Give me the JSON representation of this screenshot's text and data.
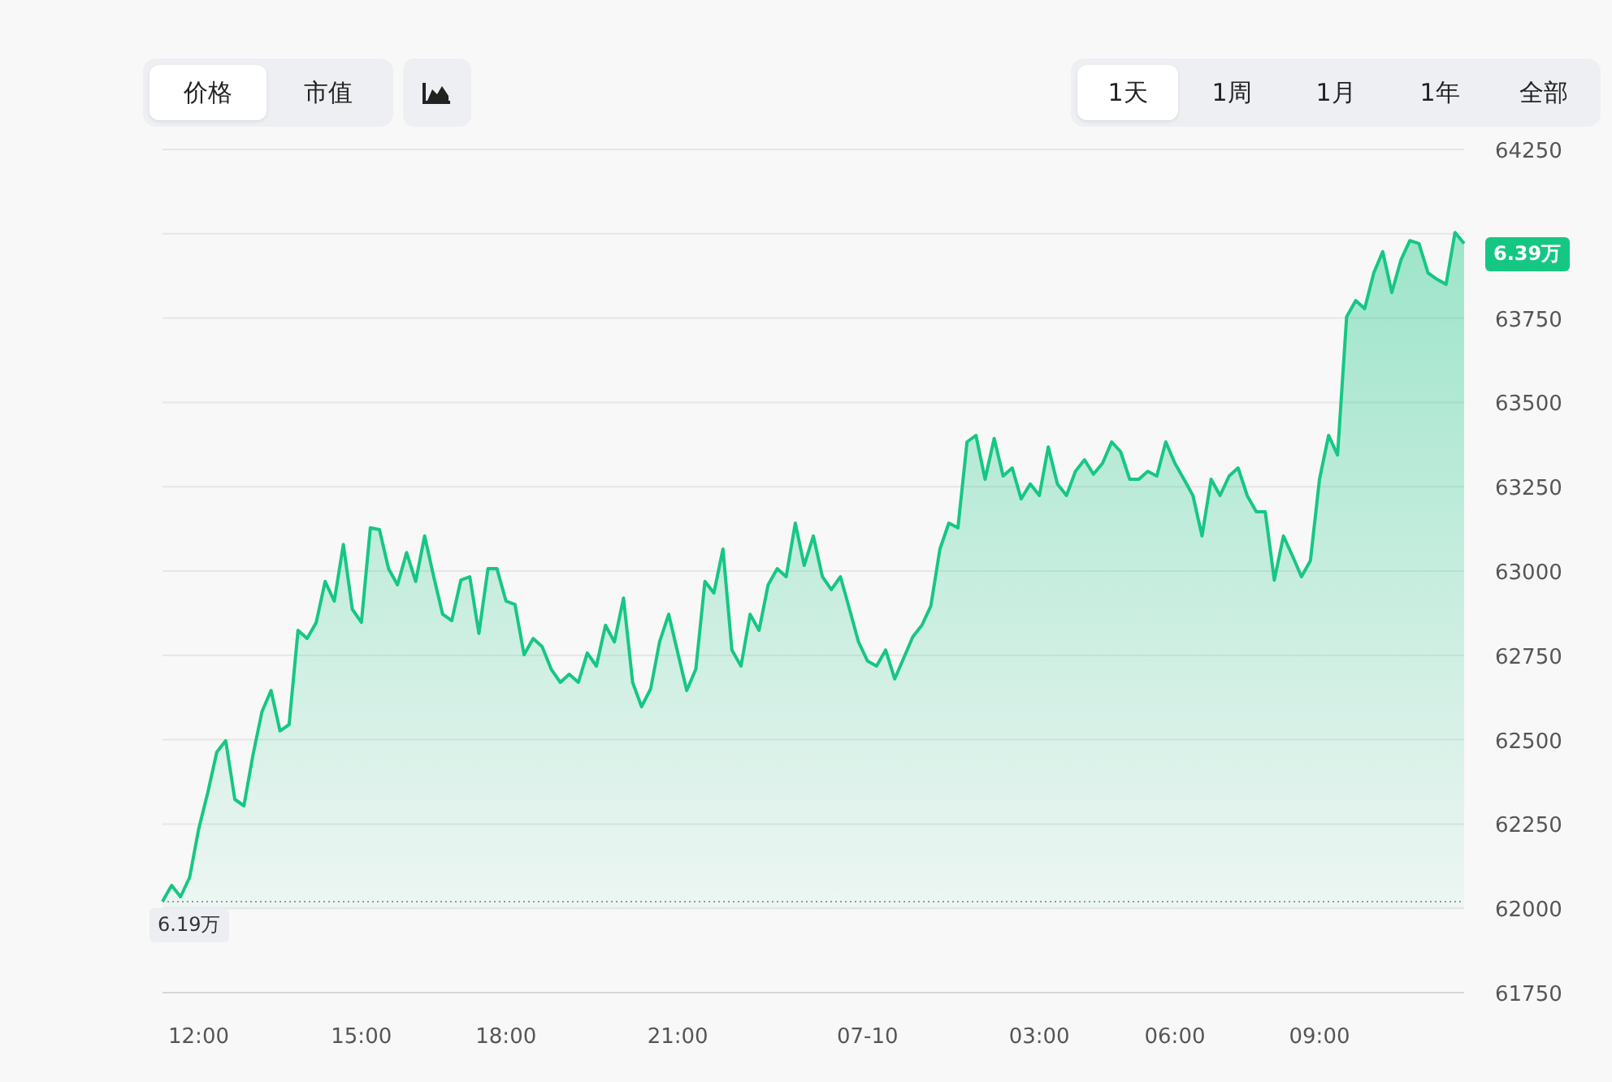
{
  "metric_tabs": [
    {
      "label": "价格",
      "selected": true
    },
    {
      "label": "市值",
      "selected": false
    }
  ],
  "range_tabs": [
    {
      "label": "1天",
      "selected": true
    },
    {
      "label": "1周",
      "selected": false
    },
    {
      "label": "1月",
      "selected": false
    },
    {
      "label": "1年",
      "selected": false
    },
    {
      "label": "全部",
      "selected": false
    }
  ],
  "chart": {
    "current_price_badge": "6.39万",
    "start_price_badge": "6.19万",
    "chart_data": {
      "type": "area",
      "categories": [
        null,
        null,
        null,
        null,
        "12:00",
        null,
        null,
        null,
        null,
        null,
        null,
        null,
        null,
        null,
        null,
        null,
        null,
        null,
        null,
        null,
        null,
        null,
        "15:00",
        null,
        null,
        null,
        null,
        null,
        null,
        null,
        null,
        null,
        null,
        null,
        null,
        null,
        null,
        null,
        "18:00",
        null,
        null,
        null,
        null,
        null,
        null,
        null,
        null,
        null,
        null,
        null,
        null,
        null,
        null,
        null,
        null,
        null,
        null,
        "21:00",
        null,
        null,
        null,
        null,
        null,
        null,
        null,
        null,
        null,
        null,
        null,
        null,
        null,
        null,
        null,
        null,
        null,
        null,
        null,
        null,
        "07-10",
        null,
        null,
        null,
        null,
        null,
        null,
        null,
        null,
        null,
        null,
        null,
        null,
        null,
        null,
        null,
        null,
        null,
        null,
        "03:00",
        null,
        null,
        null,
        null,
        null,
        null,
        null,
        null,
        null,
        null,
        null,
        null,
        null,
        null,
        "06:00",
        null,
        null,
        null,
        null,
        null,
        null,
        null,
        null,
        null,
        null,
        null,
        null,
        null,
        null,
        null,
        "09:00",
        null,
        null,
        null,
        null,
        null,
        null,
        null,
        null,
        null,
        null,
        null,
        null,
        null,
        null,
        null,
        null
      ],
      "series": [
        {
          "color": "#16c784",
          "values": [
            62020,
            62068,
            62034,
            62092,
            62236,
            62342,
            62463,
            62497,
            62323,
            62304,
            62453,
            62583,
            62646,
            62526,
            62545,
            62824,
            62800,
            62848,
            62969,
            62911,
            63079,
            62887,
            62848,
            63128,
            63123,
            63007,
            62959,
            63055,
            62969,
            63104,
            62983,
            62872,
            62853,
            62973,
            62983,
            62815,
            63007,
            63007,
            62911,
            62901,
            62752,
            62800,
            62776,
            62709,
            62670,
            62694,
            62670,
            62757,
            62718,
            62839,
            62790,
            62920,
            62670,
            62598,
            62651,
            62790,
            62872,
            62757,
            62646,
            62709,
            62969,
            62935,
            63065,
            62766,
            62718,
            62872,
            62824,
            62959,
            63007,
            62983,
            63142,
            63017,
            63104,
            62983,
            62945,
            62983,
            62887,
            62790,
            62733,
            62718,
            62766,
            62680,
            62742,
            62805,
            62839,
            62896,
            63065,
            63142,
            63128,
            63383,
            63402,
            63272,
            63393,
            63282,
            63306,
            63214,
            63258,
            63224,
            63368,
            63258,
            63224,
            63296,
            63330,
            63287,
            63320,
            63383,
            63354,
            63272,
            63272,
            63296,
            63282,
            63383,
            63320,
            63272,
            63224,
            63104,
            63272,
            63224,
            63282,
            63306,
            63224,
            63176,
            63176,
            62973,
            63104,
            63046,
            62983,
            63031,
            63272,
            63402,
            63344,
            63754,
            63802,
            63778,
            63884,
            63947,
            63826,
            63922,
            63980,
            63971,
            63884,
            63865,
            63850,
            64004,
            63971
          ]
        }
      ],
      "grid": true,
      "ref_lines": [
        {
          "axis": "y",
          "value": 62020
        }
      ],
      "ylim": [
        61750,
        64250
      ],
      "yticks": [
        61750,
        62000,
        62250,
        62500,
        62750,
        63000,
        63250,
        63500,
        63750,
        64250
      ]
    }
  }
}
